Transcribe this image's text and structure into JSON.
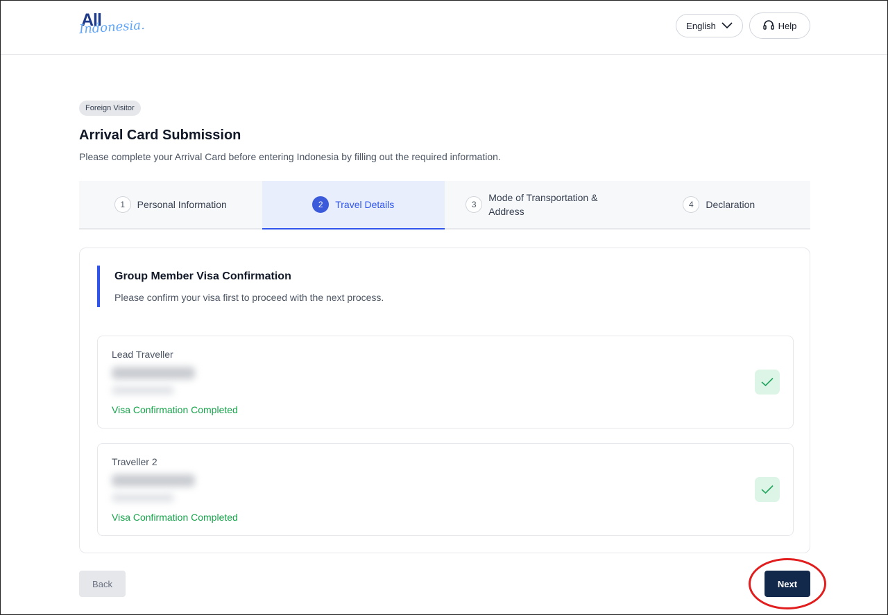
{
  "header": {
    "logo_top": "All",
    "logo_bottom": "Indonesia.",
    "language_label": "English",
    "help_label": "Help"
  },
  "page": {
    "badge": "Foreign Visitor",
    "title": "Arrival Card Submission",
    "subtitle": "Please complete your Arrival Card before entering Indonesia by filling out the required information."
  },
  "steps": [
    {
      "number": "1",
      "label": "Personal Information",
      "active": false
    },
    {
      "number": "2",
      "label": "Travel Details",
      "active": true
    },
    {
      "number": "3",
      "label": "Mode of Transportation & Address",
      "active": false
    },
    {
      "number": "4",
      "label": "Declaration",
      "active": false
    }
  ],
  "section": {
    "title": "Group Member Visa Confirmation",
    "subtitle": "Please confirm your visa first to proceed with the next process."
  },
  "travellers": [
    {
      "label": "Lead Traveller",
      "status": "Visa Confirmation Completed"
    },
    {
      "label": "Traveller 2",
      "status": "Visa Confirmation Completed"
    }
  ],
  "footer": {
    "back_label": "Back",
    "next_label": "Next"
  },
  "colors": {
    "primary": "#2f54eb",
    "navy": "#13294b",
    "success": "#16a34a",
    "highlight": "#e11d1d"
  }
}
